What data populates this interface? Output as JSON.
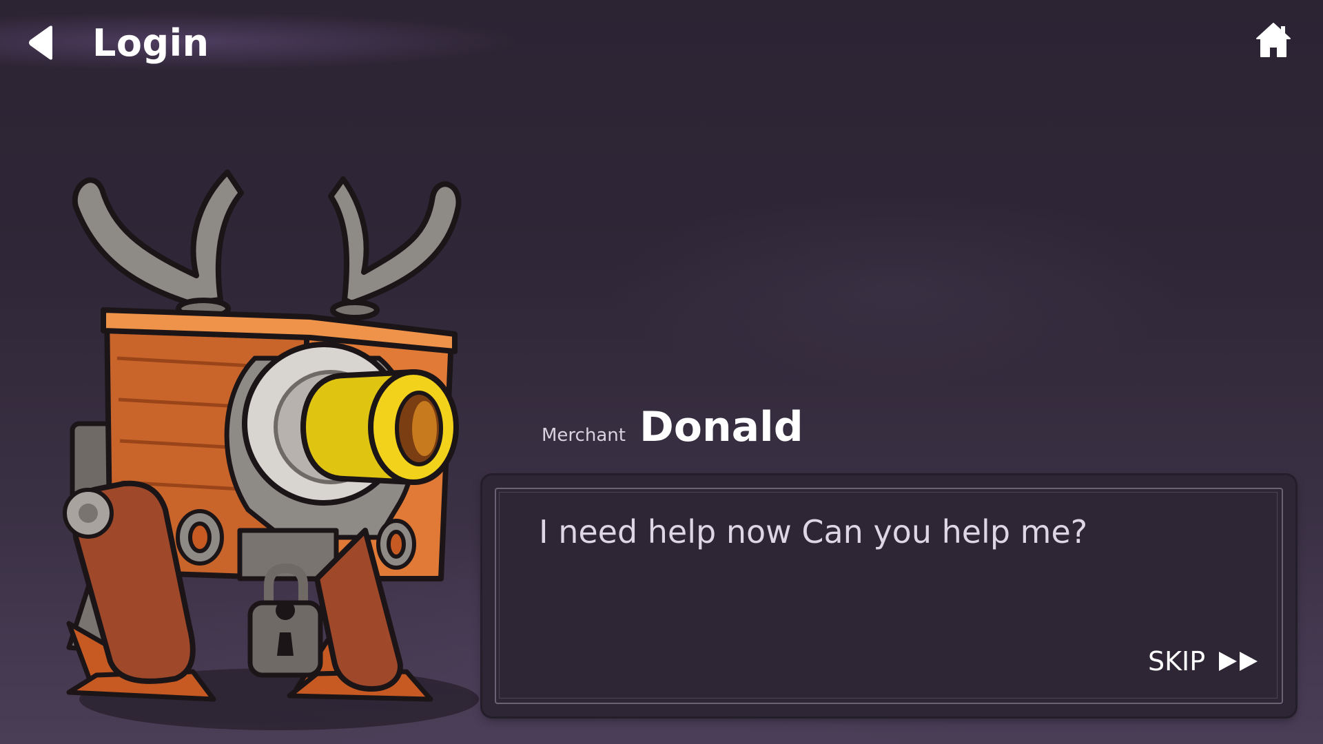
{
  "header": {
    "title": "Login",
    "back_icon": "back-arrow-icon",
    "home_icon": "home-icon"
  },
  "dialog": {
    "speaker_role": "Merchant",
    "speaker_name": "Donald",
    "text": "I need help now Can you help me?",
    "skip_label": "SKIP",
    "skip_icon": "fast-forward-icon"
  },
  "character": {
    "name": "merchant-robot-deer"
  },
  "colors": {
    "background_top": "#2c2433",
    "background_bottom": "#4a3e57",
    "dialog_box": "#2e2635",
    "dialog_text": "#ddd6e4",
    "character_body": "#e07a36",
    "character_lens": "#f2d21a",
    "character_antlers": "#8e8a86"
  }
}
